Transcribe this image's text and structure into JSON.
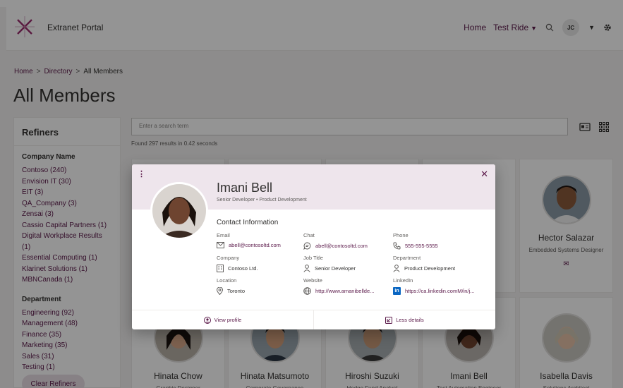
{
  "header": {
    "portal_title": "Extranet Portal",
    "nav_home": "Home",
    "nav_test_ride": "Test Ride",
    "user_initials": "JC"
  },
  "breadcrumb": {
    "home": "Home",
    "directory": "Directory",
    "current": "All Members",
    "separator": ">"
  },
  "page": {
    "title": "All Members"
  },
  "refiners": {
    "title": "Refiners",
    "company_heading": "Company Name",
    "company_items": [
      "Contoso (240)",
      "Envision IT (30)",
      "EIT (3)",
      "QA_Company (3)",
      "Zensai (3)",
      "Cassio Capital Partners (1)",
      "Digital Workplace Results (1)",
      "Essential Computing (1)",
      "Klarinet Solutions (1)",
      "MBNCanada (1)"
    ],
    "department_heading": "Department",
    "department_items": [
      "Engineering (92)",
      "Management (48)",
      "Finance (35)",
      "Marketing (35)",
      "Sales (31)",
      "Testing (1)"
    ],
    "clear_label": "Clear Refiners"
  },
  "search": {
    "placeholder": "Enter a search term",
    "results": "Found 297 results in 0.42 seconds"
  },
  "cards": [
    {
      "name": "Hector Salazar",
      "role": "Embedded Systems Designer"
    },
    {
      "name": "Hinata Chow",
      "role": "Graphic Designer"
    },
    {
      "name": "Hinata Matsumoto",
      "role": "Corporate Governance"
    },
    {
      "name": "Hiroshi Suzuki",
      "role": "Hedge Fund Analyst"
    },
    {
      "name": "Imani Bell",
      "role": "Test Automation Engineer"
    },
    {
      "name": "Isabella Davis",
      "role": "Solutions Architect"
    }
  ],
  "modal": {
    "name": "Imani Bell",
    "subtitle": "Senior Developer  •  Product Development",
    "contact_title": "Contact Information",
    "email_label": "Email",
    "email": "abell@contosoltd.com",
    "chat_label": "Chat",
    "chat": "abell@contosoltd.com",
    "phone_label": "Phone",
    "phone": "555-555-5555",
    "company_label": "Company",
    "company": "Contoso Ltd.",
    "job_label": "Job Title",
    "job": "Senior Developer",
    "dept_label": "Department",
    "dept": "Product Development",
    "location_label": "Location",
    "location": "Toronto",
    "website_label": "Website",
    "website": "http://www.amanibellde...",
    "linkedin_label": "LinkedIn",
    "linkedin": "https://ca.linkedin.comM/in/j...",
    "view_profile": "View profile",
    "less_details": "Less details"
  },
  "colors": {
    "accent": "#5c1b4b",
    "band": "#eee5ec"
  }
}
